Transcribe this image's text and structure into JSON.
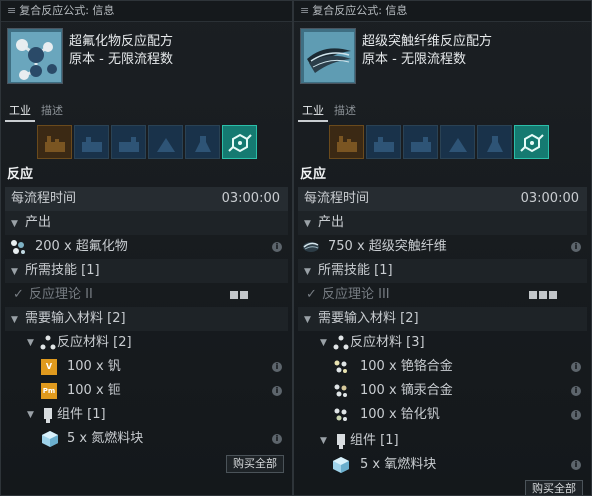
{
  "windows": [
    {
      "title": "复合反应公式: 信息",
      "item_name": "超氟化物反应配方",
      "item_subtitle": "原本 - 无限流程数",
      "tabs": [
        "工业",
        "描述"
      ],
      "section_title": "反应",
      "time_label": "每流程时间",
      "time_value": "03:00:00",
      "output_label": "产出",
      "output_text": "200 x 超氟化物",
      "skills_label": "所需技能 [1]",
      "skill_name": "反应理论 II",
      "skill_level": 2,
      "materials_label": "需要输入材料 [2]",
      "reaction_materials_label": "反应材料 [2]",
      "reaction_materials": [
        {
          "text": "100 x 钒",
          "icon": "V"
        },
        {
          "text": "100 x 钷",
          "icon": "Pm"
        }
      ],
      "components_label": "组件 [1]",
      "components": [
        {
          "text": "5 x 氮燃料块"
        }
      ],
      "buy_all_label": "购买全部"
    },
    {
      "title": "复合反应公式: 信息",
      "item_name": "超级突触纤维反应配方",
      "item_subtitle": "原本 - 无限流程数",
      "tabs": [
        "工业",
        "描述"
      ],
      "section_title": "反应",
      "time_label": "每流程时间",
      "time_value": "03:00:00",
      "output_label": "产出",
      "output_text": "750 x 超级突触纤维",
      "skills_label": "所需技能 [1]",
      "skill_name": "反应理论 III",
      "skill_level": 3,
      "materials_label": "需要输入材料 [2]",
      "reaction_materials_label": "反应材料 [3]",
      "reaction_materials": [
        {
          "text": "100 x 铯铬合金"
        },
        {
          "text": "100 x 镝汞合金"
        },
        {
          "text": "100 x 铪化钒"
        }
      ],
      "components_label": "组件 [1]",
      "components": [
        {
          "text": "5 x 氧燃料块"
        }
      ],
      "buy_all_label": "购买全部"
    }
  ],
  "info_glyph": "i",
  "colors": {
    "accent_teal": "#157a71",
    "tab_blue": "#19324a",
    "tab_brown": "#3b2914"
  }
}
